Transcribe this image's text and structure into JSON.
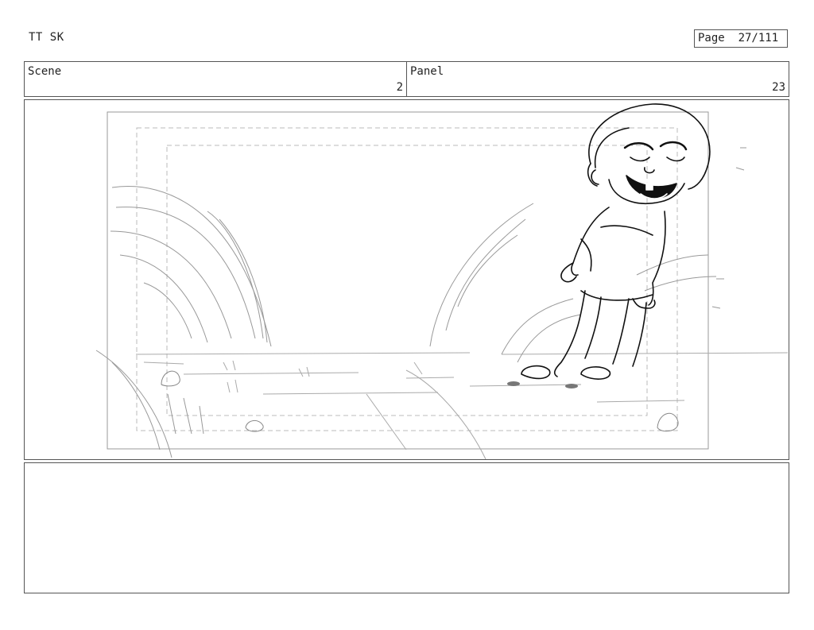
{
  "header": {
    "title": "TT SK",
    "page_label": "Page",
    "page_number": "27/111"
  },
  "info": {
    "scene_label": "Scene",
    "scene_value": "2",
    "panel_label": "Panel",
    "panel_value": "23"
  },
  "drawing": {
    "description_icon": "storyboard-sketch"
  },
  "notes": {
    "text": ""
  }
}
